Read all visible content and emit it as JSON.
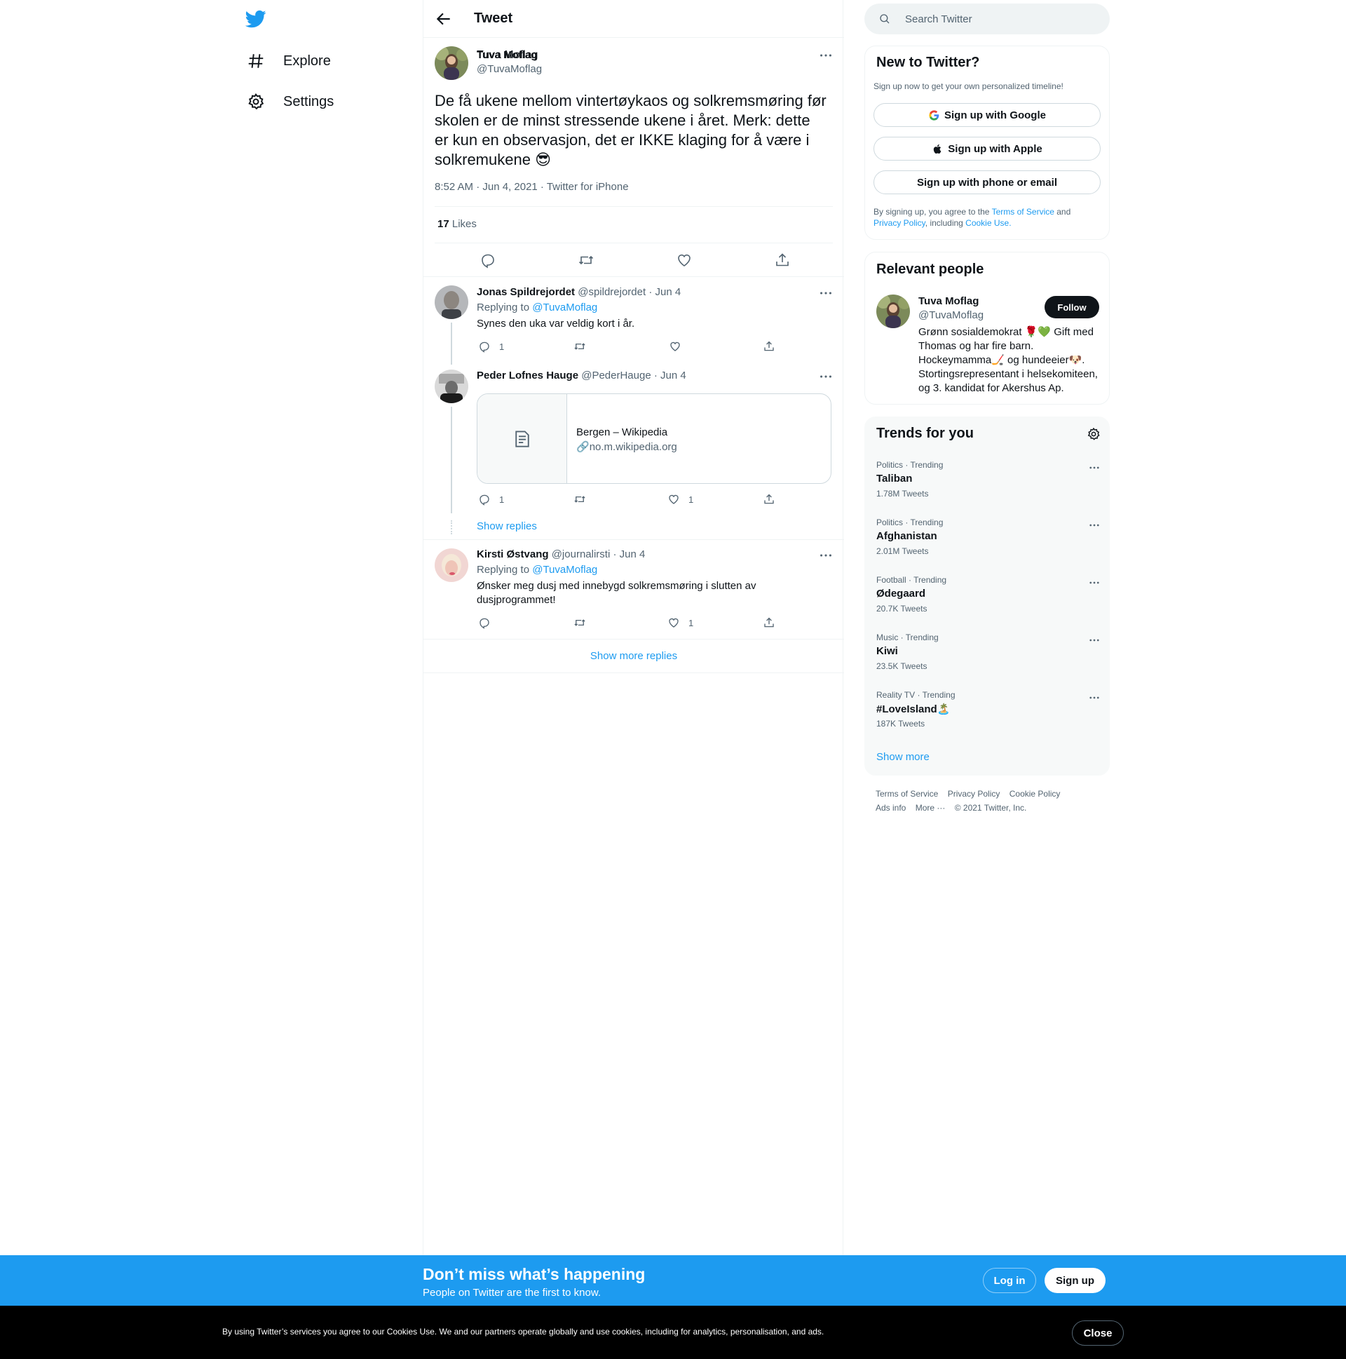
{
  "nav": {
    "logo_icon": "twitter-bird-icon",
    "items": [
      {
        "label": "Explore",
        "icon": "hashtag-icon"
      },
      {
        "label": "Settings",
        "icon": "gear-icon"
      }
    ]
  },
  "header": {
    "title": "Tweet"
  },
  "tweet": {
    "author_name": "Tuva Moflag",
    "author_handle": "@TuvaMoflag",
    "text": "De få ukene mellom vintertøykaos og solkremsmøring før skolen er de minst stressende ukene i året. Merk: dette er kun en observasjon, det er IKKE klaging for å være i solkremukene 😎",
    "meta": "8:52 AM · Jun 4, 2021 · Twitter for iPhone",
    "likes_count": "17",
    "likes_label": "Likes"
  },
  "replies": [
    {
      "name": "Jonas Spildrejordet",
      "handle_date": "@spildrejordet · Jun 4",
      "replying_label": "Replying to",
      "replying_to": "@TuvaMoflag",
      "text": "Synes den uka var veldig kort i år.",
      "reply_count": "1",
      "like_count": ""
    },
    {
      "name": "Peder Lofnes Hauge",
      "handle_date": "@PederHauge · Jun 4",
      "card_title": "Bergen – Wikipedia",
      "card_domain": "no.m.wikipedia.org",
      "reply_count": "1",
      "like_count": "1"
    },
    {
      "name": "Kirsti Østvang",
      "handle_date": "@journalirsti · Jun 4",
      "replying_label": "Replying to",
      "replying_to": "@TuvaMoflag",
      "text": "Ønsker meg dusj med innebygd solkremsmøring i slutten av dusjprogrammet!",
      "reply_count": "",
      "like_count": "1"
    }
  ],
  "show_replies": "Show replies",
  "show_more_replies": "Show more replies",
  "search": {
    "placeholder": "Search Twitter"
  },
  "new_to_twitter": {
    "title": "New to Twitter?",
    "subtitle": "Sign up now to get your own personalized timeline!",
    "google": "Sign up with Google",
    "apple": "Sign up with Apple",
    "phone": "Sign up with phone or email",
    "legal_1": "By signing up, you agree to the ",
    "terms": "Terms of Service",
    "legal_2": " and ",
    "privacy": "Privacy Policy",
    "legal_3": ", including ",
    "cookie": "Cookie Use."
  },
  "relevant": {
    "title": "Relevant people",
    "name": "Tuva Moflag",
    "handle": "@TuvaMoflag",
    "follow": "Follow",
    "bio": "Grønn sosialdemokrat 🌹💚 Gift med Thomas og har fire barn. Hockeymamma🏒 og hundeeier🐶. Stortingsrepresentant i helsekomiteen, og 3. kandidat for Akershus Ap."
  },
  "trends": {
    "title": "Trends for you",
    "items": [
      {
        "category": "Politics · Trending",
        "name": "Taliban",
        "count": "1.78M Tweets"
      },
      {
        "category": "Politics · Trending",
        "name": "Afghanistan",
        "count": "2.01M Tweets"
      },
      {
        "category": "Football · Trending",
        "name": "Ødegaard",
        "count": "20.7K Tweets"
      },
      {
        "category": "Music · Trending",
        "name": "Kiwi",
        "count": "23.5K Tweets"
      },
      {
        "category": "Reality TV · Trending",
        "name": "#LoveIsland🏝️",
        "count": "187K Tweets"
      }
    ],
    "show_more": "Show more"
  },
  "footer": {
    "terms": "Terms of Service",
    "privacy": "Privacy Policy",
    "cookie": "Cookie Policy",
    "ads": "Ads info",
    "more": "More ···",
    "copyright": "© 2021 Twitter, Inc."
  },
  "banner": {
    "title": "Don’t miss what’s happening",
    "subtitle": "People on Twitter are the first to know.",
    "login": "Log in",
    "signup": "Sign up"
  },
  "cookie_bar": {
    "text": "By using Twitter’s services you agree to our Cookies Use. We and our partners operate globally and use cookies, including for analytics, personalisation, and ads.",
    "close": "Close"
  },
  "colors": {
    "accent": "#1d9bf0",
    "text": "#0f1419",
    "muted": "#536471",
    "border": "#eff3f4"
  }
}
